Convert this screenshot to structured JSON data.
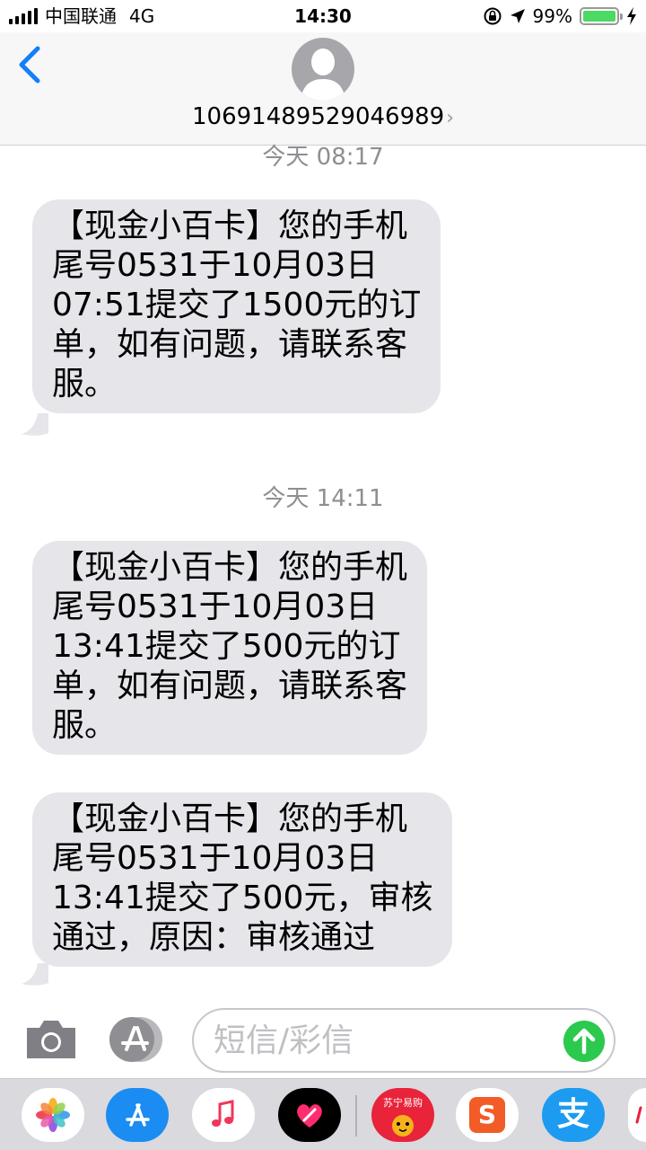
{
  "status_bar": {
    "carrier": "中国联通",
    "network": "4G",
    "time": "14:30",
    "battery_percent": "99%",
    "battery_level": 0.99,
    "icons": [
      "signal-icon",
      "rotation-lock-icon",
      "location-icon",
      "battery-icon",
      "charging-icon"
    ]
  },
  "header": {
    "back_icon": "chevron-left-icon",
    "contact_number": "10691489529046989",
    "contact_chevron": "›"
  },
  "messages": [
    {
      "timestamp": "今天 08:17",
      "lines": [
        "【现金小百卡】您的手机",
        "尾号0531于10月03日",
        "07:51提交了1500元的订",
        "单，如有问题，请联系客",
        "服。"
      ]
    },
    {
      "timestamp": "今天 14:11",
      "lines": [
        "【现金小百卡】您的手机",
        "尾号0531于10月03日",
        "13:41提交了500元的订",
        "单，如有问题，请联系客",
        "服。"
      ]
    },
    {
      "timestamp": "",
      "lines": [
        "【现金小百卡】您的手机",
        "尾号0531于10月03日",
        "13:41提交了500元，审核",
        "通过，原因：审核通过"
      ]
    }
  ],
  "composer": {
    "placeholder": "短信/彩信",
    "camera_icon": "camera-icon",
    "apps_icon": "app-store-icon",
    "send_icon": "send-arrow-icon"
  },
  "app_drawer": {
    "apps": [
      "photos-app-icon",
      "app-store-app-icon",
      "music-app-icon",
      "digital-touch-app-icon",
      "suning-app-icon",
      "sogou-app-icon",
      "alipay-app-icon",
      "more-app-icon"
    ],
    "suning_label": "苏宁易购",
    "alipay_label": "支",
    "sogou_label": "S"
  },
  "colors": {
    "bubble": "#e5e5ea",
    "accent_blue": "#147efb",
    "send_green": "#2bc94d",
    "timestamp_gray": "#8e8e93"
  }
}
